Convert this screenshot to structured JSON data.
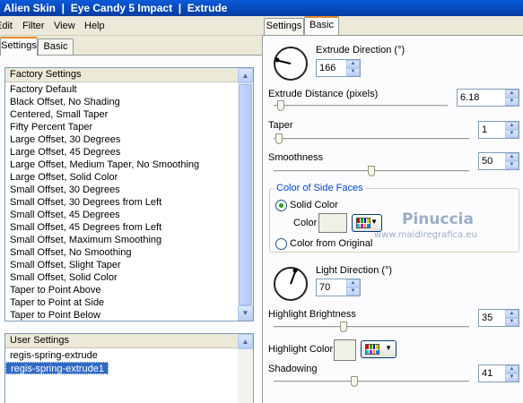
{
  "window": {
    "title": "Alien Skin  |  Eye Candy 5 Impact  |  Extrude"
  },
  "menu": [
    "Edit",
    "Filter",
    "View",
    "Help"
  ],
  "left_tabs": [
    "Settings",
    "Basic"
  ],
  "factory": {
    "header": "Factory Settings",
    "items": [
      "Factory Default",
      "Black Offset, No Shading",
      "Centered, Small Taper",
      "Fifty Percent Taper",
      "Large Offset, 30 Degrees",
      "Large Offset, 45 Degrees",
      "Large Offset, Medium Taper, No Smoothing",
      "Large Offset, Solid Color",
      "Small Offset, 30 Degrees",
      "Small Offset, 30 Degrees from Left",
      "Small Offset, 45 Degrees",
      "Small Offset, 45 Degrees from Left",
      "Small Offset, Maximum Smoothing",
      "Small Offset, No Smoothing",
      "Small Offset, Slight Taper",
      "Small Offset, Solid Color",
      "Taper to Point Above",
      "Taper to Point at Side",
      "Taper to Point Below"
    ]
  },
  "user": {
    "header": "User Settings",
    "items": [
      "regis-spring-extrude",
      "regis-spring-extrude1"
    ],
    "selected_index": 1
  },
  "right_tabs": [
    "Settings",
    "Basic"
  ],
  "basic": {
    "extrude_direction": {
      "label": "Extrude Direction (°)",
      "value": "166"
    },
    "extrude_distance": {
      "label": "Extrude Distance (pixels)",
      "value": "6.18",
      "level": 0.02
    },
    "taper": {
      "label": "Taper",
      "value": "1",
      "level": 0.01
    },
    "smoothness": {
      "label": "Smoothness",
      "value": "50",
      "level": 0.5
    },
    "side_faces": {
      "legend": "Color of Side Faces",
      "solid_label": "Solid Color",
      "color_label": "Color",
      "original_label": "Color from Original"
    },
    "light_direction": {
      "label": "Light Direction (°)",
      "value": "70"
    },
    "highlight_brightness": {
      "label": "Highlight Brightness",
      "value": "35",
      "level": 0.35
    },
    "highlight_color": {
      "label": "Highlight Color"
    },
    "shadowing": {
      "label": "Shadowing",
      "value": "41",
      "level": 0.41
    }
  },
  "watermark": {
    "line1": "Pinuccia",
    "line2": "www.maidiregrafica.eu"
  },
  "colors": {
    "selection": "#316ac5",
    "titlebar": "#0a5ad8",
    "swatch": "#f0f0e6"
  }
}
